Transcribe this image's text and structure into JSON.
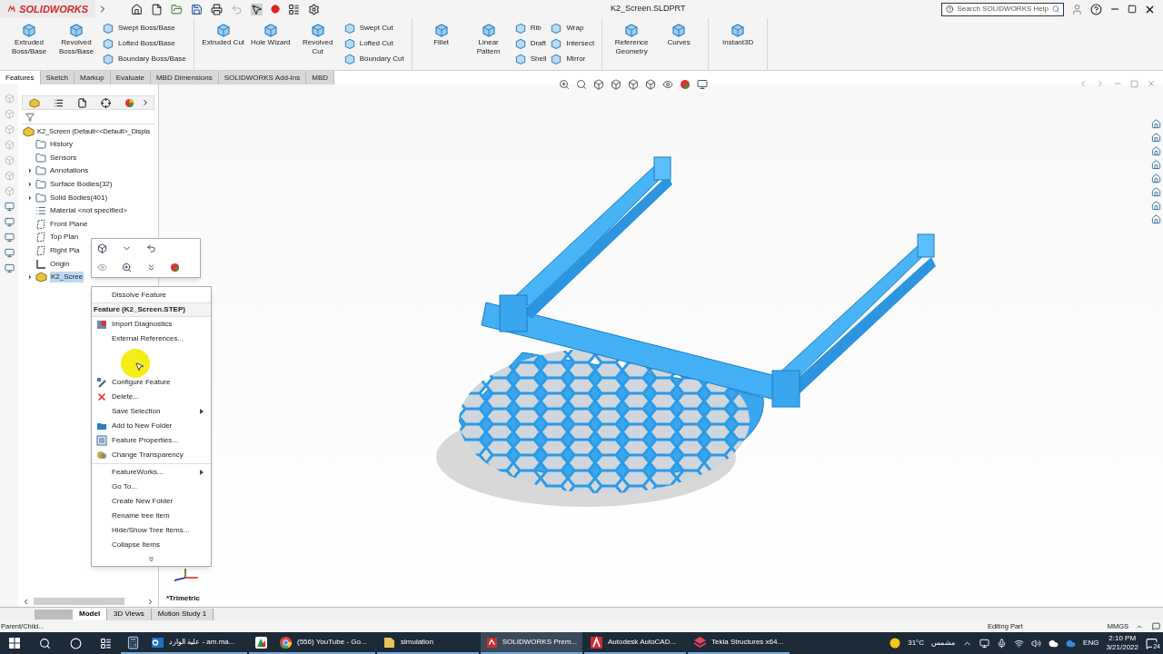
{
  "title_bar": {
    "logo": "SOLIDWORKS",
    "title": "K2_Screen.SLDPRT",
    "search": {
      "placeholder": "Search SOLIDWORKS Help"
    }
  },
  "ribbon": {
    "groups": [
      {
        "large": [
          "Extruded Boss/Base",
          "Revolved Boss/Base"
        ],
        "small": [
          [
            "Swept Boss/Base",
            "Lofted Boss/Base",
            "Boundary Boss/Base"
          ]
        ]
      },
      {
        "large": [
          "Extruded Cut",
          "Hole Wizard",
          "Revolved Cut"
        ],
        "small": [
          [
            "Swept Cut",
            "Lofted Cut",
            "Boundary Cut"
          ]
        ]
      },
      {
        "large": [
          "Fillet",
          "Linear Pattern"
        ],
        "small": [
          [
            "Rib",
            "Draft",
            "Shell"
          ],
          [
            "Wrap",
            "Intersect",
            "Mirror"
          ]
        ]
      },
      {
        "large": [
          "Reference Geometry",
          "Curves"
        ]
      },
      {
        "large": [
          "Instant3D"
        ]
      }
    ]
  },
  "tabs": [
    {
      "label": "Features",
      "selected": true
    },
    {
      "label": "Sketch",
      "selected": false
    },
    {
      "label": "Markup",
      "selected": false
    },
    {
      "label": "Evaluate",
      "selected": false
    },
    {
      "label": "MBD Dimensions",
      "selected": false
    },
    {
      "label": "SOLIDWORKS Add-Ins",
      "selected": false
    },
    {
      "label": "MBD",
      "selected": false
    }
  ],
  "feature_tree": {
    "root": "K2_Screen  (Default<<Default>_Displa",
    "items": [
      {
        "label": "History",
        "kind": "folder",
        "expandable": false,
        "selected": false
      },
      {
        "label": "Sensors",
        "kind": "folder",
        "expandable": false,
        "selected": false
      },
      {
        "label": "Annotations",
        "kind": "folder",
        "expandable": true,
        "selected": false
      },
      {
        "label": "Surface Bodies(32)",
        "kind": "folder",
        "expandable": true,
        "selected": false
      },
      {
        "label": "Solid Bodies(401)",
        "kind": "folder",
        "expandable": true,
        "selected": false
      },
      {
        "label": "Material <not specified>",
        "kind": "material",
        "expandable": false,
        "selected": false
      },
      {
        "label": "Front Plane",
        "kind": "plane",
        "expandable": false,
        "selected": false
      },
      {
        "label": "Top Plan",
        "kind": "plane",
        "expandable": false,
        "selected": false
      },
      {
        "label": "Right Pla",
        "kind": "plane",
        "expandable": false,
        "selected": false
      },
      {
        "label": "Origin",
        "kind": "origin",
        "expandable": false,
        "selected": false
      },
      {
        "label": "K2_Scree",
        "kind": "part",
        "expandable": true,
        "selected": true
      }
    ]
  },
  "context_menu": {
    "items": [
      {
        "kind": "plain",
        "label": "Dissolve Feature",
        "submenu": false
      },
      {
        "kind": "header",
        "label": "Feature (K2_Screen.STEP)"
      },
      {
        "kind": "diagnostics",
        "label": "Import Diagnostics",
        "submenu": false
      },
      {
        "kind": "plain",
        "label": "External References...",
        "submenu": false
      },
      {
        "kind": "blank"
      },
      {
        "kind": "configure",
        "label": "Configure Feature",
        "submenu": false
      },
      {
        "kind": "delete",
        "label": "Delete...",
        "submenu": false
      },
      {
        "kind": "plain",
        "label": "Save Selection",
        "submenu": true
      },
      {
        "kind": "folder",
        "label": "Add to New Folder",
        "submenu": false
      },
      {
        "kind": "properties",
        "label": "Feature Properties...",
        "submenu": false
      },
      {
        "kind": "transparency",
        "label": "Change Transparency",
        "submenu": false
      },
      {
        "kind": "separator"
      },
      {
        "kind": "plain",
        "label": "FeatureWorks...",
        "submenu": true
      },
      {
        "kind": "plain",
        "label": "Go To...",
        "submenu": false
      },
      {
        "kind": "plain",
        "label": "Create New Folder",
        "submenu": false
      },
      {
        "kind": "plain",
        "label": "Rename tree item",
        "submenu": false
      },
      {
        "kind": "plain",
        "label": "Hide/Show Tree Items...",
        "submenu": false
      },
      {
        "kind": "plain",
        "label": "Collapse Items",
        "submenu": false
      }
    ]
  },
  "viewport": {
    "view_label": "*Trimetric"
  },
  "bottom_tabs": [
    {
      "label": "Model",
      "selected": true
    },
    {
      "label": "3D Views",
      "selected": false
    },
    {
      "label": "Motion Study 1",
      "selected": false
    }
  ],
  "status_bar": {
    "message": "Parent/Child...",
    "mode": "Editing Part",
    "units": "MMGS"
  },
  "taskbar": {
    "apps": [
      {
        "kind": "calculator",
        "active": false
      },
      {
        "kind": "outlook",
        "label": "علية الوارد - am.ma...",
        "active": false
      },
      {
        "kind": "app",
        "active": false
      },
      {
        "kind": "chrome",
        "label": "(556) YouTube - Go...",
        "active": false
      },
      {
        "kind": "folder",
        "label": "simulation",
        "active": false
      },
      {
        "kind": "solidworks",
        "label": "SOLIDWORKS Prem...",
        "active": true
      },
      {
        "kind": "autocad",
        "label": "Autodesk AutoCAD...",
        "active": false
      },
      {
        "kind": "tekla",
        "label": "Tekla Structures x64...",
        "active": false
      }
    ],
    "weather": {
      "temperature": "31°C",
      "condition": "مشمس"
    },
    "language": "ENG",
    "time": "2:10 PM",
    "date": "3/21/2022",
    "notifications": "24"
  }
}
